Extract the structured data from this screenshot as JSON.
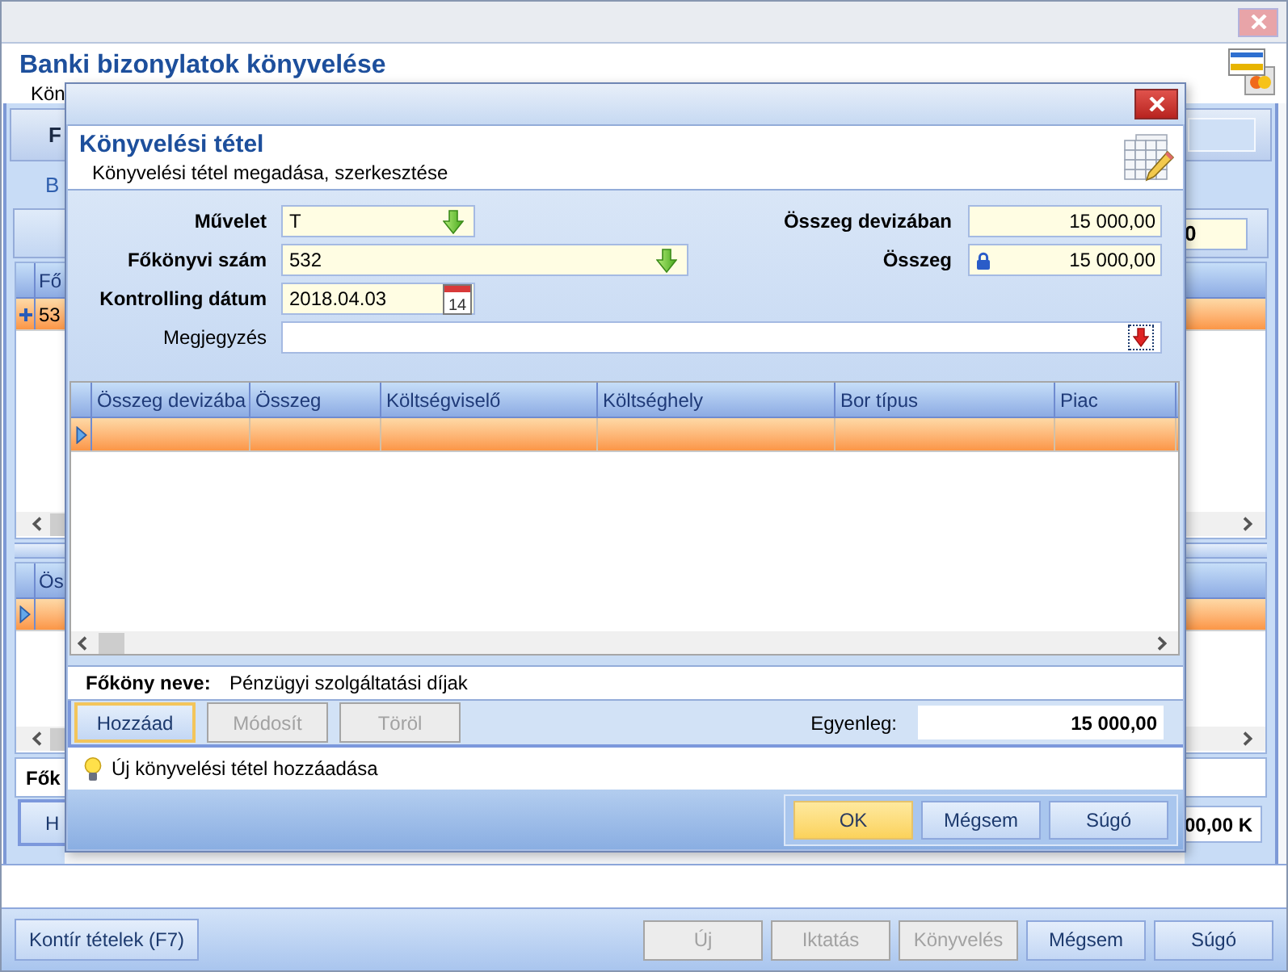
{
  "window": {
    "title": "Banki bizonylatok könyvelése",
    "subtitle": "Kön"
  },
  "background": {
    "tab": "F",
    "section": "B",
    "field": "0",
    "grid": {
      "header": "Fő",
      "rows": [
        {
          "text": "53",
          "selected": true
        }
      ]
    },
    "grid2": {
      "header": "Ös",
      "rows": [
        {
          "selected": true
        }
      ]
    },
    "label": "Fők",
    "button": "H",
    "total": "00,00 K"
  },
  "dialog": {
    "title": "Könyvelési tétel",
    "subtitle": "Könyvelési tétel megadása, szerkesztése",
    "fields_left": [
      {
        "label": "Művelet",
        "value": "T",
        "kind": "lookup",
        "required": true
      },
      {
        "label": "Főkönyvi szám",
        "value": "532",
        "kind": "lookup",
        "required": true
      },
      {
        "label": "Kontrolling dátum",
        "value": "2018.04.03",
        "kind": "date",
        "required": true,
        "icon_text": "14"
      },
      {
        "label": "Megjegyzés",
        "kind": "memo",
        "required": false
      }
    ],
    "fields_right": [
      {
        "label": "Összeg devizában",
        "value": "15 000,00",
        "locked": false
      },
      {
        "label": "Összeg",
        "value": "15 000,00",
        "locked": true
      }
    ],
    "table": {
      "columns": [
        "Összeg devizába",
        "Összeg",
        "Költségviselő",
        "Költséghely",
        "Bor típus",
        "Piac"
      ],
      "rows": [
        {
          "selected": true
        }
      ]
    },
    "account_name": {
      "label": "Főköny neve:",
      "value": "Pénzügyi szolgáltatási díjak"
    },
    "actions": [
      {
        "label": "Hozzáad",
        "disabled": false,
        "focused": true
      },
      {
        "label": "Módosít",
        "disabled": true,
        "focused": false
      },
      {
        "label": "Töröl",
        "disabled": true,
        "focused": false
      }
    ],
    "balance": {
      "label": "Egyenleg:",
      "value": "15 000,00"
    },
    "hint": "Új könyvelési tétel hozzáadása",
    "buttons": [
      {
        "label": "OK",
        "highlighted": true
      },
      {
        "label": "Mégsem",
        "highlighted": false
      },
      {
        "label": "Súgó",
        "highlighted": false
      }
    ]
  },
  "footer": {
    "left": [
      {
        "label": "Kontír tételek (F7)",
        "disabled": false
      }
    ],
    "right": [
      {
        "label": "Új",
        "disabled": true
      },
      {
        "label": "Iktatás",
        "disabled": true
      },
      {
        "label": "Könyvelés",
        "disabled": true
      },
      {
        "label": "Mégsem",
        "disabled": false
      },
      {
        "label": "Súgó",
        "disabled": false
      }
    ]
  }
}
